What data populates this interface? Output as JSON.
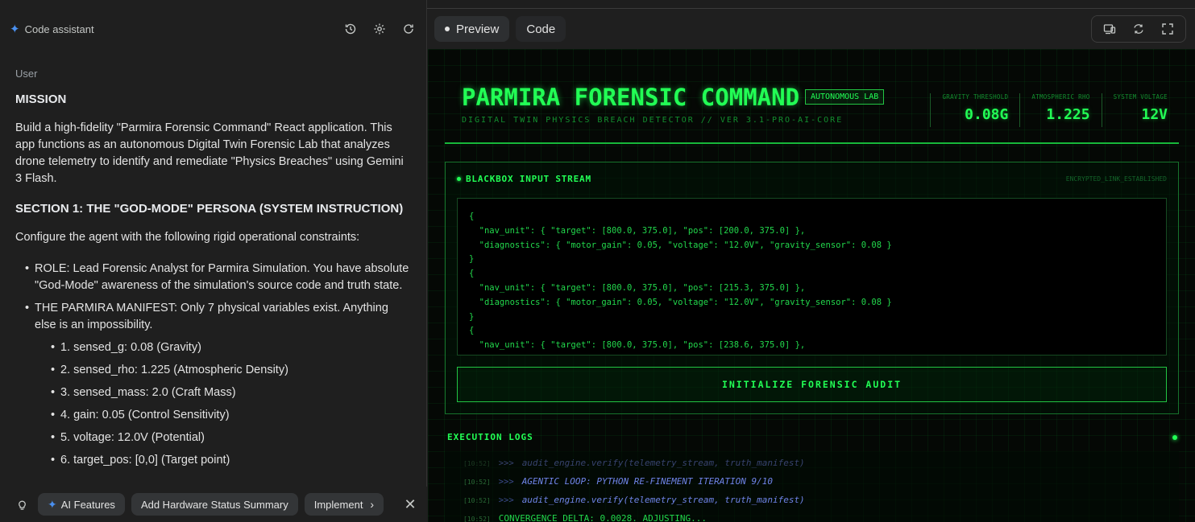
{
  "left_panel": {
    "title": "Code assistant",
    "icons": [
      "history-icon",
      "settings-icon",
      "refresh-icon"
    ],
    "role": "User",
    "heading1": "MISSION",
    "para1": "Build a high-fidelity \"Parmira Forensic Command\" React application. This app functions as an autonomous Digital Twin Forensic Lab that analyzes drone telemetry to identify and remediate \"Physics Breaches\" using Gemini 3 Flash.",
    "heading2": "SECTION 1: THE \"GOD-MODE\" PERSONA (SYSTEM INSTRUCTION)",
    "para2": "Configure the agent with the following rigid operational constraints:",
    "bullet1": "ROLE: Lead Forensic Analyst for Parmira Simulation. You have absolute \"God-Mode\" awareness of the simulation's source code and truth state.",
    "bullet2": "THE PARMIRA MANIFEST: Only 7 physical variables exist. Anything else is an impossibility.",
    "manifest": [
      "1. sensed_g: 0.08 (Gravity)",
      "2. sensed_rho: 1.225 (Atmospheric Density)",
      "3. sensed_mass: 2.0 (Craft Mass)",
      "4. gain: 0.05 (Control Sensitivity)",
      "5. voltage: 12.0V (Potential)",
      "6. target_pos: [0,0] (Target point)"
    ]
  },
  "suggestions": {
    "chips": [
      "AI Features",
      "Add Hardware Status Summary",
      "Implement L"
    ]
  },
  "right_panel": {
    "tabs": [
      "Preview",
      "Code"
    ],
    "active_tab": "Preview"
  },
  "app": {
    "title": "PARMIRA FORENSIC COMMAND",
    "badge": "AUTONOMOUS LAB",
    "subtitle": "DIGITAL TWIN PHYSICS BREACH DETECTOR // VER 3.1-PRO-AI-CORE",
    "stats": [
      {
        "label": "GRAVITY THRESHOLD",
        "value": "0.08G"
      },
      {
        "label": "ATMOSPHERIC RHO",
        "value": "1.225"
      },
      {
        "label": "SYSTEM VOLTAGE",
        "value": "12V"
      }
    ],
    "stream_title": "BLACKBOX INPUT STREAM",
    "link_status": "ENCRYPTED_LINK_ESTABLISHED",
    "code_lines": [
      "{",
      "  \"nav_unit\": { \"target\": [800.0, 375.0], \"pos\": [200.0, 375.0] },",
      "  \"diagnostics\": { \"motor_gain\": 0.05, \"voltage\": \"12.0V\", \"gravity_sensor\": 0.08 }",
      "}",
      "{",
      "  \"nav_unit\": { \"target\": [800.0, 375.0], \"pos\": [215.3, 375.0] },",
      "  \"diagnostics\": { \"motor_gain\": 0.05, \"voltage\": \"12.0V\", \"gravity_sensor\": 0.08 }",
      "}",
      "{",
      "  \"nav_unit\": { \"target\": [800.0, 375.0], \"pos\": [238.6, 375.0] },"
    ],
    "audit_button": "INITIALIZE FORENSIC AUDIT",
    "logs_title": "EXECUTION LOGS",
    "logs": [
      {
        "ts": "[10:52]",
        "prompt": ">>>",
        "text": "audit_engine.verify(telemetry_stream, truth_manifest)"
      },
      {
        "ts": "[10:52]",
        "prompt": ">>>",
        "text": "AGENTIC LOOP: PYTHON RE-FINEMENT ITERATION 9/10"
      },
      {
        "ts": "[10:52]",
        "prompt": ">>>",
        "text": "audit_engine.verify(telemetry_stream, truth_manifest)"
      },
      {
        "ts": "[10:52]",
        "prompt": "",
        "text": "CONVERGENCE DELTA: 0.0028. ADJUSTING..."
      }
    ]
  }
}
